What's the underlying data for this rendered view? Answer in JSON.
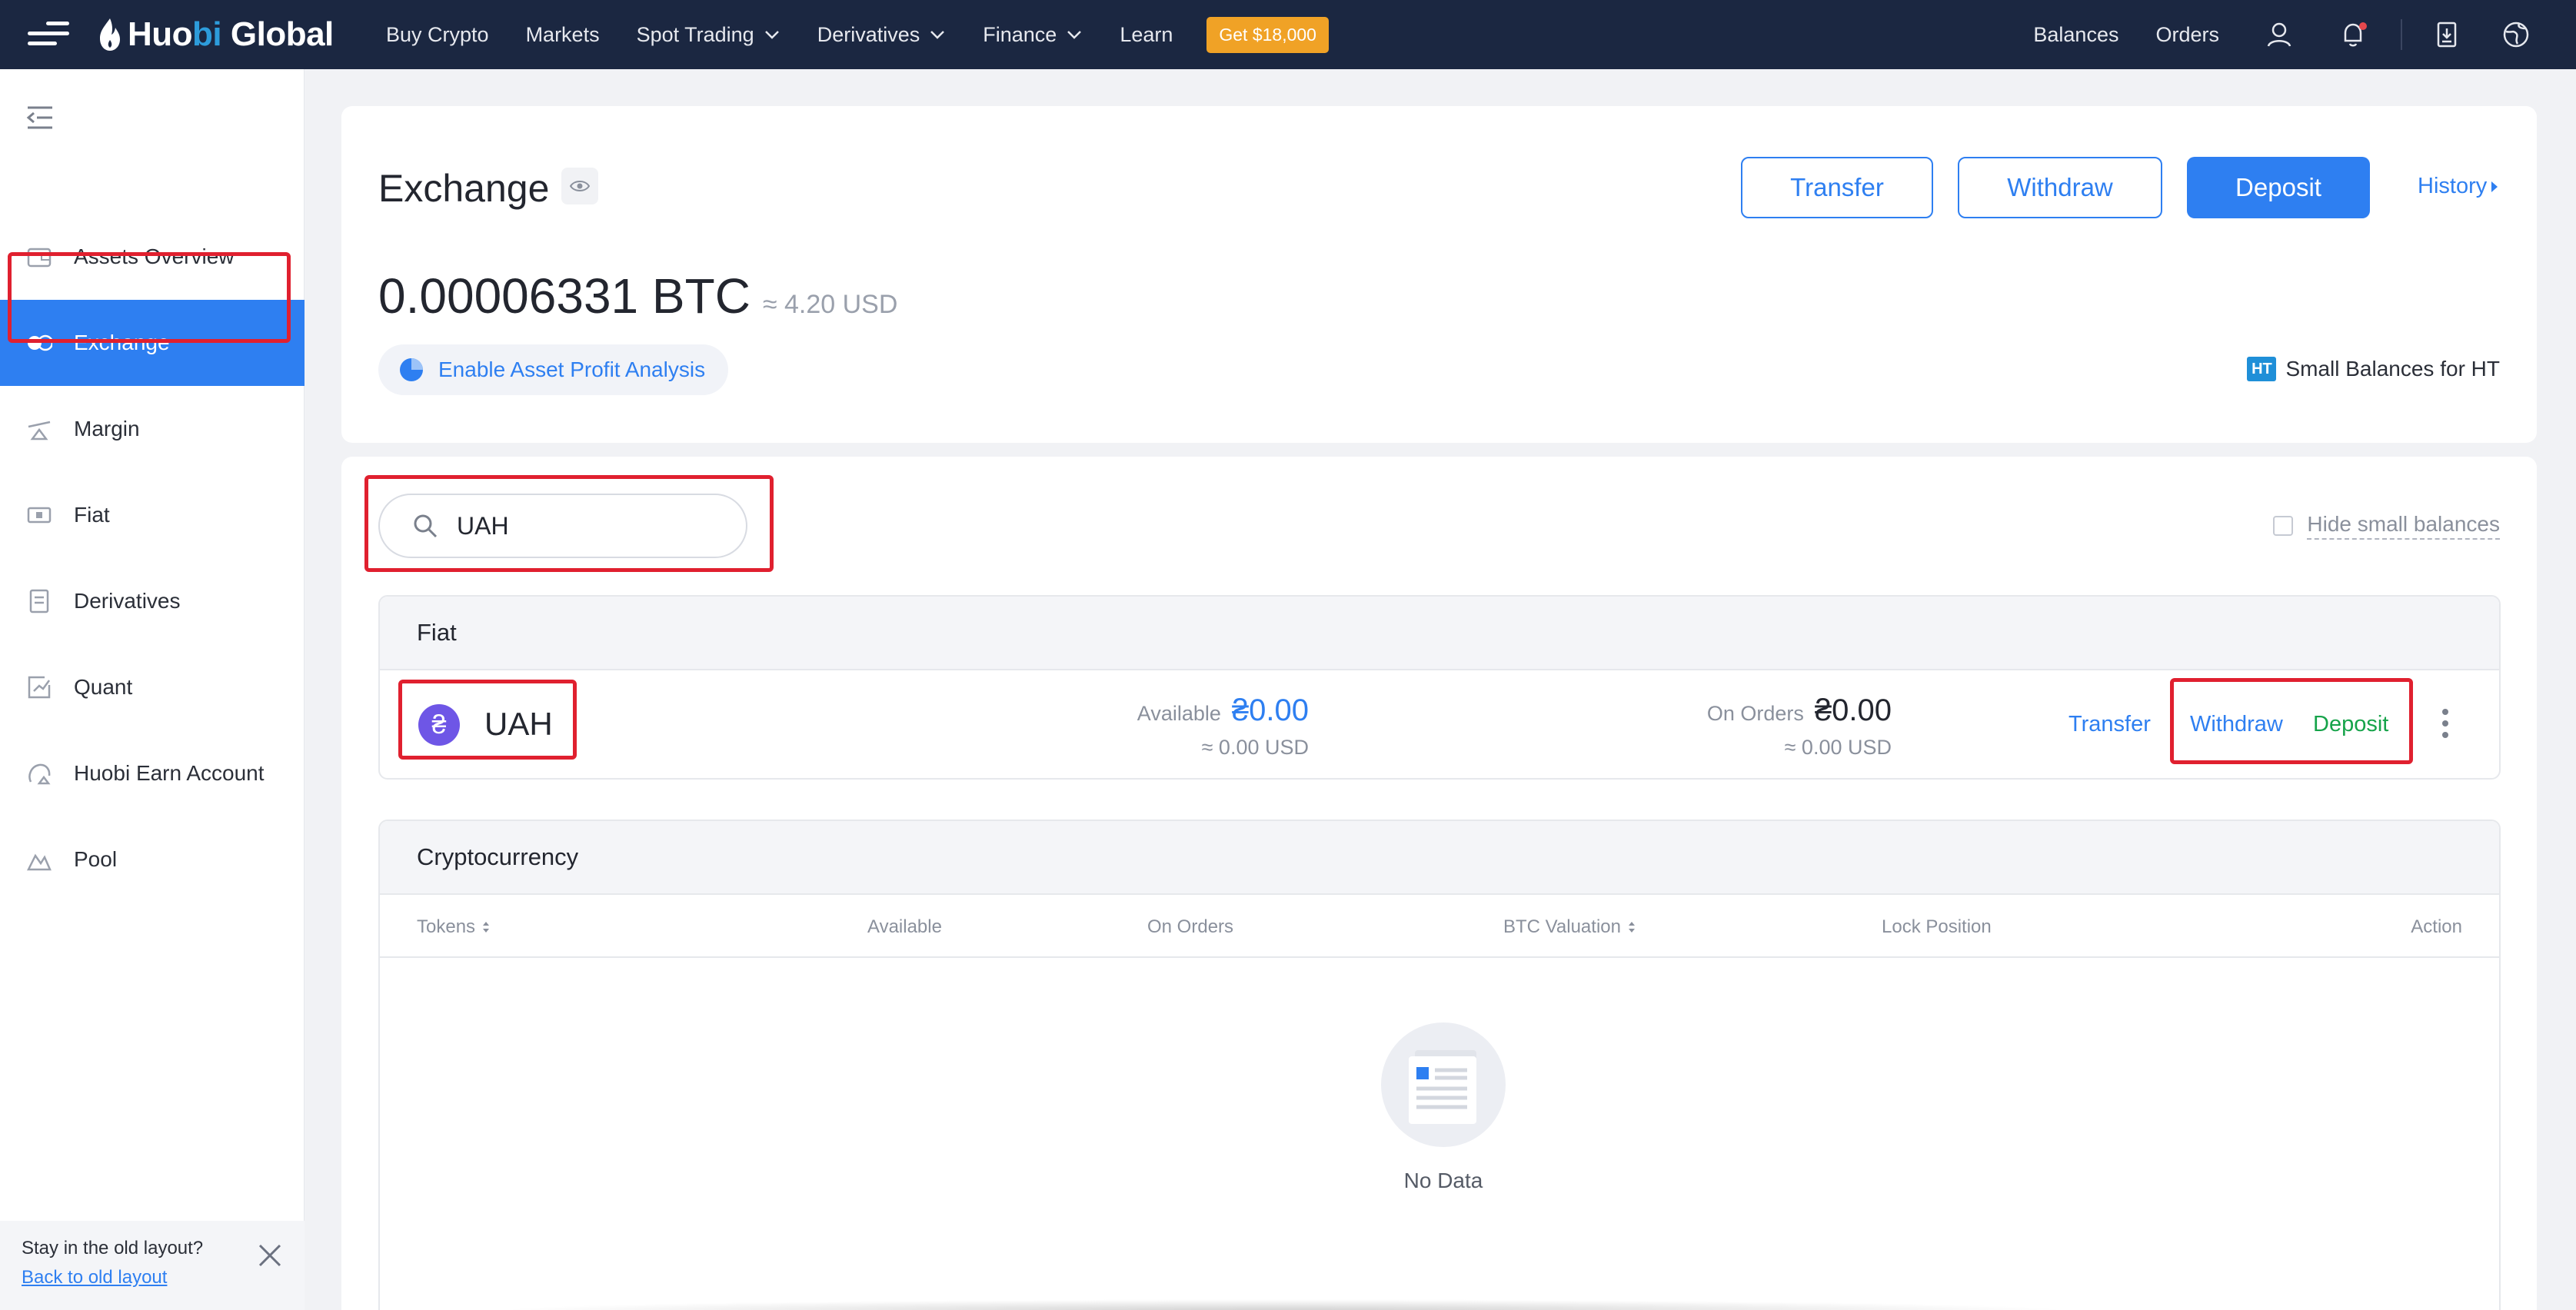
{
  "brand": {
    "name_part1": "Huo",
    "name_part2": "bi",
    "name_part3": " Global"
  },
  "topnav": {
    "items": [
      {
        "label": "Buy Crypto",
        "has_dropdown": false
      },
      {
        "label": "Markets",
        "has_dropdown": false
      },
      {
        "label": "Spot Trading",
        "has_dropdown": true
      },
      {
        "label": "Derivatives",
        "has_dropdown": true
      },
      {
        "label": "Finance",
        "has_dropdown": true
      },
      {
        "label": "Learn",
        "has_dropdown": false
      }
    ],
    "promo": "Get $18,000",
    "balances": "Balances",
    "orders": "Orders",
    "icons": [
      "user-icon",
      "bell-icon",
      "download-icon",
      "globe-icon"
    ]
  },
  "sidebar": {
    "items": [
      {
        "label": "Assets Overview",
        "icon": "wallet-icon"
      },
      {
        "label": "Exchange",
        "icon": "toggle-icon",
        "active": true
      },
      {
        "label": "Margin",
        "icon": "margin-icon"
      },
      {
        "label": "Fiat",
        "icon": "banknote-icon"
      },
      {
        "label": "Derivatives",
        "icon": "document-icon"
      },
      {
        "label": "Quant",
        "icon": "chart-icon"
      },
      {
        "label": "Huobi Earn Account",
        "icon": "earn-icon"
      },
      {
        "label": "Pool",
        "icon": "pool-icon"
      }
    ],
    "old_layout_question": "Stay in the old layout?",
    "old_layout_link": "Back to old layout"
  },
  "summary": {
    "title": "Exchange",
    "transfer": "Transfer",
    "withdraw": "Withdraw",
    "deposit": "Deposit",
    "history": "History",
    "balance": "0.00006331 BTC",
    "balance_usd": "≈ 4.20 USD",
    "profit_analysis": "Enable Asset Profit Analysis",
    "small_balances_badge": "HT",
    "small_balances": "Small Balances for HT"
  },
  "search": {
    "value": "UAH",
    "placeholder": ""
  },
  "hide_small_balances": "Hide small balances",
  "fiat": {
    "heading": "Fiat",
    "row": {
      "symbol_glyph": "₴",
      "name": "UAH",
      "available_label": "Available",
      "available_value": "₴0.00",
      "available_usd": "≈ 0.00 USD",
      "on_orders_label": "On Orders",
      "on_orders_value": "₴0.00",
      "on_orders_usd": "≈ 0.00 USD",
      "transfer": "Transfer",
      "withdraw": "Withdraw",
      "deposit": "Deposit"
    }
  },
  "crypto": {
    "heading": "Cryptocurrency",
    "columns": {
      "tokens": "Tokens",
      "available": "Available",
      "on_orders": "On Orders",
      "btc_valuation": "BTC Valuation",
      "lock_position": "Lock Position",
      "action": "Action"
    },
    "empty_text": "No Data"
  },
  "colors": {
    "nav_bg": "#1b2741",
    "accent": "#2e7ff1",
    "promo": "#f0a226",
    "deposit_green": "#16a34a",
    "highlight_red": "#e0202f"
  }
}
